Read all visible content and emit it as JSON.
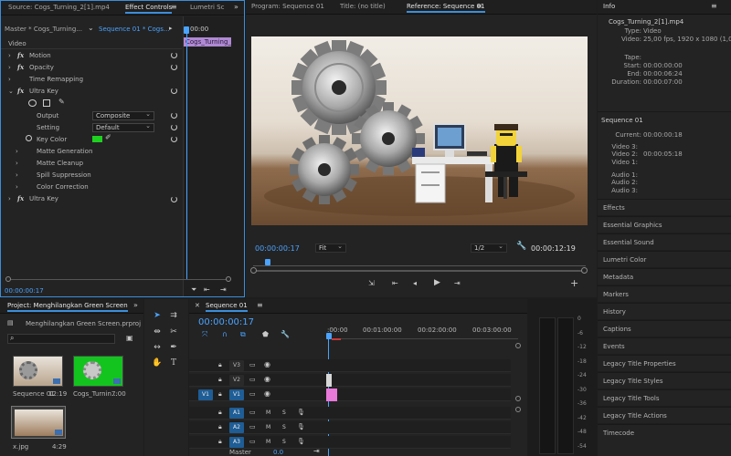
{
  "effect_controls": {
    "tabs": [
      "Source: Cogs_Turning_2[1].mp4",
      "Effect Controls",
      "Lumetri Sc"
    ],
    "master_label": "Master * Cogs_Turning...",
    "sequence_label": "Sequence 01 * Cogs...",
    "clip_label": "Cogs_Turning_2[1]",
    "tc_head": "00:00",
    "section": "Video",
    "rows": {
      "motion": "Motion",
      "opacity": "Opacity",
      "time_remap": "Time Remapping",
      "ultra_key": "Ultra Key",
      "output_label": "Output",
      "output_value": "Composite",
      "setting_label": "Setting",
      "setting_value": "Default",
      "key_color_label": "Key Color",
      "matte_gen": "Matte Generation",
      "matte_clean": "Matte Cleanup",
      "spill": "Spill Suppression",
      "color_corr": "Color Correction",
      "ultra_key2": "Ultra Key"
    },
    "fx_symbol": "fx",
    "timecode": "00:00:00:17",
    "key_color_hex": "#20d020"
  },
  "program": {
    "tabs": [
      "Program: Sequence 01",
      "Title: (no title)",
      "Reference: Sequence 01"
    ],
    "timecode": "00:00:00:17",
    "fit": "Fit",
    "quality": "1/2",
    "duration": "00:00:12:19"
  },
  "info": {
    "title": "Info",
    "clip": "Cogs_Turning_2[1].mp4",
    "type_key": "Type:",
    "type_val": "Video",
    "video_key": "Video:",
    "video_val": "25,00 fps, 1920 x 1080 (1,0)",
    "tape_key": "Tape:",
    "start_key": "Start:",
    "start_val": "00:00:00:00",
    "end_key": "End:",
    "end_val": "00:00:06:24",
    "dur_key": "Duration:",
    "dur_val": "00:00:07:00",
    "seq": "Sequence 01",
    "current_key": "Current:",
    "current_val": "00:00:00:18",
    "v3_key": "Video 3:",
    "v2_key": "Video 2:",
    "v2_val": "00:00:05:18",
    "v1_key": "Video 1:",
    "a1_key": "Audio 1:",
    "a2_key": "Audio 2:",
    "a3_key": "Audio 3:"
  },
  "right_panels": [
    "Effects",
    "Essential Graphics",
    "Essential Sound",
    "Lumetri Color",
    "Metadata",
    "Markers",
    "History",
    "Captions",
    "Events",
    "Legacy Title Properties",
    "Legacy Title Styles",
    "Legacy Title Tools",
    "Legacy Title Actions",
    "Timecode"
  ],
  "project": {
    "tab": "Project: Menghilangkan Green Screen",
    "file": "Menghilangkan Green Screen.prproj",
    "items": [
      {
        "name": "Sequence 01",
        "dur": "12:19"
      },
      {
        "name": "Cogs_Turnin...",
        "dur": "7:00"
      },
      {
        "name": "x.jpg",
        "dur": "4:29"
      }
    ]
  },
  "timeline": {
    "tab": "Sequence 01",
    "timecode": "00:00:00:17",
    "ruler": [
      ":00:00",
      "00:01:00:00",
      "00:02:00:00",
      "00:03:00:00"
    ],
    "tracks": [
      {
        "name": "V3",
        "src": ""
      },
      {
        "name": "V2",
        "src": ""
      },
      {
        "name": "V1",
        "src": "V1"
      },
      {
        "name": "A1",
        "src": "",
        "m": "M",
        "s": "S"
      },
      {
        "name": "A2",
        "src": "",
        "m": "M",
        "s": "S"
      },
      {
        "name": "A3",
        "src": "",
        "m": "M",
        "s": "S"
      }
    ],
    "master": "Master",
    "master_val": "0.0"
  },
  "meter": [
    "0",
    "-6",
    "-12",
    "-18",
    "-24",
    "-30",
    "-36",
    "-42",
    "-48",
    "-54"
  ]
}
